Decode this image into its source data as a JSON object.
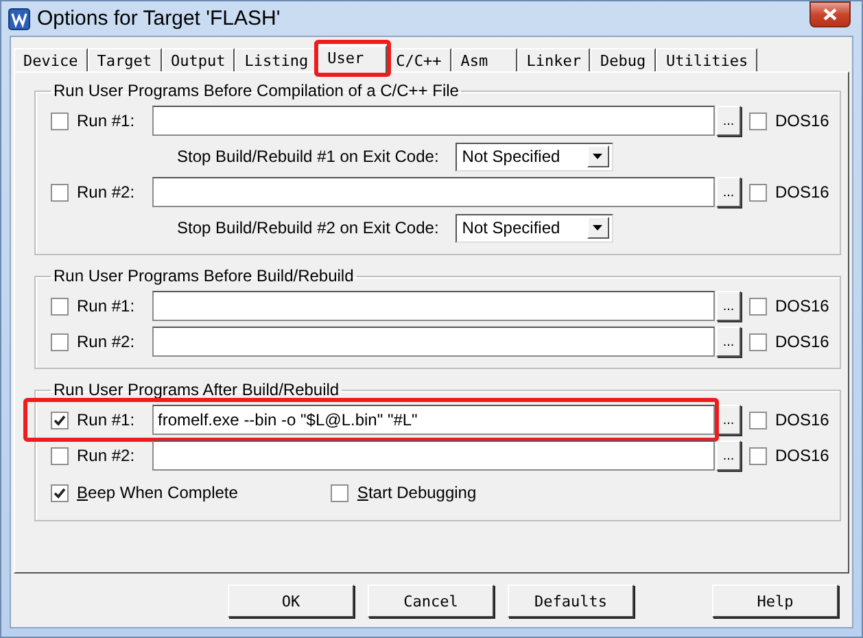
{
  "window": {
    "title": "Options for Target 'FLASH'"
  },
  "tabs": [
    {
      "label": "Device",
      "selected": false,
      "annotated": false
    },
    {
      "label": "Target",
      "selected": false,
      "annotated": false
    },
    {
      "label": "Output",
      "selected": false,
      "annotated": false
    },
    {
      "label": "Listing",
      "selected": false,
      "annotated": false
    },
    {
      "label": "User",
      "selected": true,
      "annotated": true
    },
    {
      "label": "C/C++",
      "selected": false,
      "annotated": false
    },
    {
      "label": "Asm",
      "selected": false,
      "annotated": false
    },
    {
      "label": "Linker",
      "selected": false,
      "annotated": false
    },
    {
      "label": "Debug",
      "selected": false,
      "annotated": false
    },
    {
      "label": "Utilities",
      "selected": false,
      "annotated": false
    }
  ],
  "groups": [
    {
      "title": "Run User Programs Before Compilation of a C/C++ File",
      "rows": [
        {
          "kind": "run",
          "label": "Run #1:",
          "checked": false,
          "value": "",
          "browse": "...",
          "dos16": {
            "label": "DOS16",
            "checked": false
          },
          "annotated": false
        },
        {
          "kind": "exit",
          "label": "Stop Build/Rebuild #1 on Exit Code:",
          "dropdown": "Not Specified"
        },
        {
          "kind": "run",
          "label": "Run #2:",
          "checked": false,
          "value": "",
          "browse": "...",
          "dos16": {
            "label": "DOS16",
            "checked": false
          },
          "annotated": false
        },
        {
          "kind": "exit",
          "label": "Stop Build/Rebuild #2 on Exit Code:",
          "dropdown": "Not Specified"
        }
      ]
    },
    {
      "title": "Run User Programs Before Build/Rebuild",
      "rows": [
        {
          "kind": "run",
          "label": "Run #1:",
          "checked": false,
          "value": "",
          "browse": "...",
          "dos16": {
            "label": "DOS16",
            "checked": false
          },
          "annotated": false
        },
        {
          "kind": "run",
          "label": "Run #2:",
          "checked": false,
          "value": "",
          "browse": "...",
          "dos16": {
            "label": "DOS16",
            "checked": false
          },
          "annotated": false
        }
      ]
    },
    {
      "title": "Run User Programs After Build/Rebuild",
      "rows": [
        {
          "kind": "run",
          "label": "Run #1:",
          "checked": true,
          "value": "fromelf.exe --bin -o \"$L@L.bin\" \"#L\"",
          "browse": "...",
          "dos16": {
            "label": "DOS16",
            "checked": false
          },
          "annotated": true
        },
        {
          "kind": "run",
          "label": "Run #2:",
          "checked": false,
          "value": "",
          "browse": "...",
          "dos16": {
            "label": "DOS16",
            "checked": false
          },
          "annotated": false
        },
        {
          "kind": "options",
          "items": [
            {
              "label": "Beep When Complete",
              "checked": true
            },
            {
              "label": "Start Debugging",
              "checked": false
            }
          ]
        }
      ]
    }
  ],
  "buttons": [
    {
      "label": "OK"
    },
    {
      "label": "Cancel"
    },
    {
      "label": "Defaults"
    },
    {
      "label": "Help"
    }
  ]
}
